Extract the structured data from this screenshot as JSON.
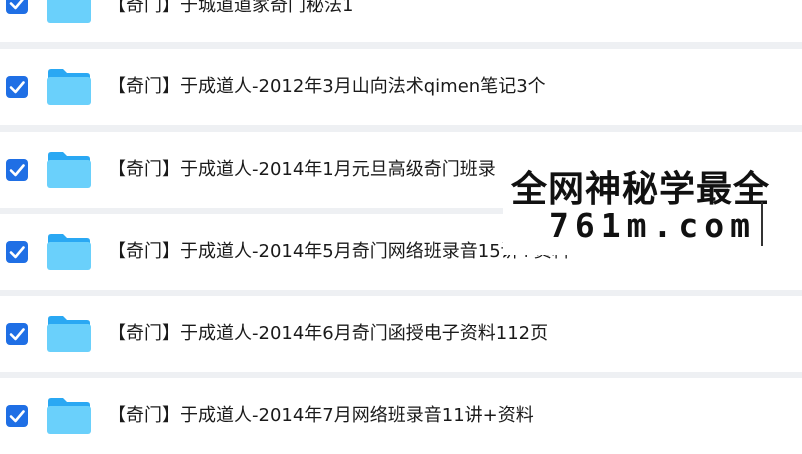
{
  "colors": {
    "page_bg": "#eef0f3",
    "row_bg": "#ffffff",
    "checkbox": "#1f6fe5",
    "folder_light": "#6ad0fb",
    "folder_dark": "#2aa8f3"
  },
  "icons": {
    "checkbox": "checkbox-checked-icon",
    "folder": "folder-icon"
  },
  "files": [
    {
      "name": "【奇门】于城道道家奇门秘法1",
      "checked": true
    },
    {
      "name": "【奇门】于成道人-2012年3月山向法术qimen笔记3个",
      "checked": true
    },
    {
      "name": "【奇门】于成道人-2014年1月元旦高级奇门班录",
      "checked": true
    },
    {
      "name": "【奇门】于成道人-2014年5月奇门网络班录音15讲+资料",
      "checked": true
    },
    {
      "name": "【奇门】于成道人-2014年6月奇门函授电子资料112页",
      "checked": true
    },
    {
      "name": "【奇门】于成道人-2014年7月网络班录音11讲+资料",
      "checked": true
    }
  ],
  "watermark": {
    "title": "全网神秘学最全",
    "url": "761m.com"
  }
}
